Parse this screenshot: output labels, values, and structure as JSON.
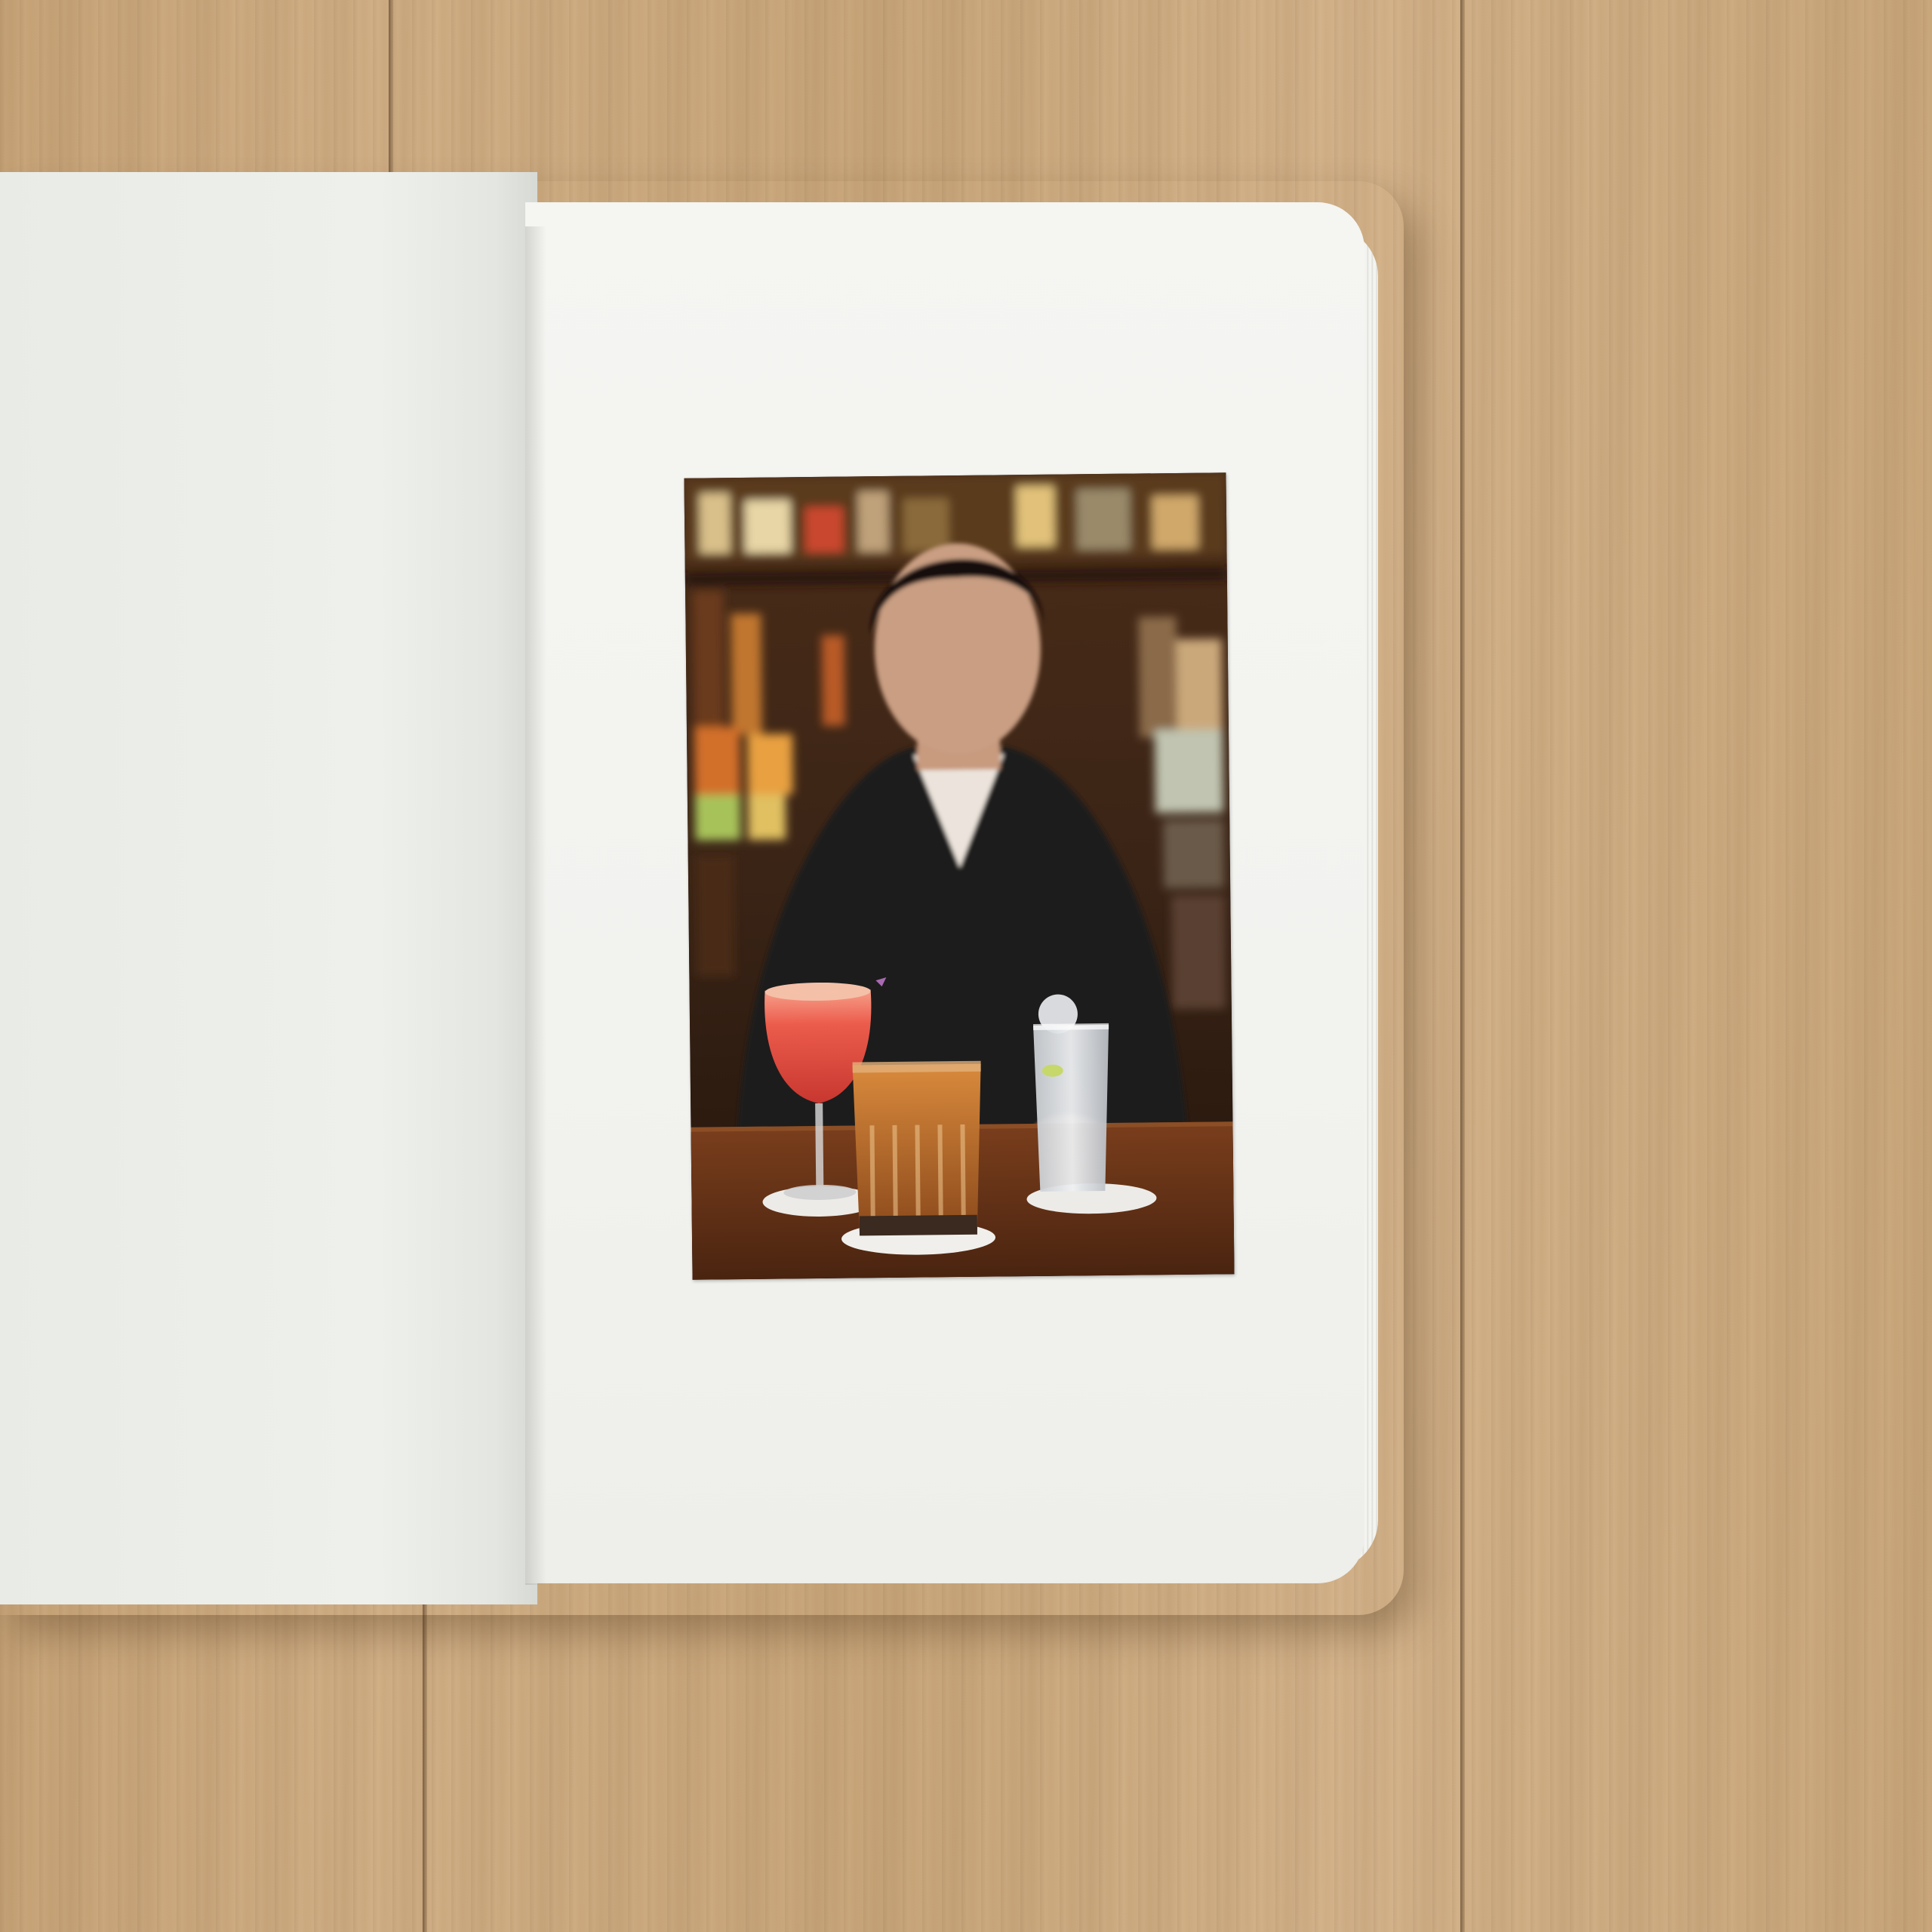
{
  "scene": {
    "background": "wooden-table",
    "object": "open-notebook",
    "photo_subject": "bartender-with-cocktails"
  },
  "colors": {
    "wood": "#cfae83",
    "paper": "#f3f3f0",
    "bar_backdrop": "#3a2416",
    "suit": "#1c1a1f",
    "cocktail_red": "#e8544a",
    "whisky_amber": "#c8742e",
    "highball_clear": "#d9dde0",
    "counter_wood": "#5a2e16"
  }
}
